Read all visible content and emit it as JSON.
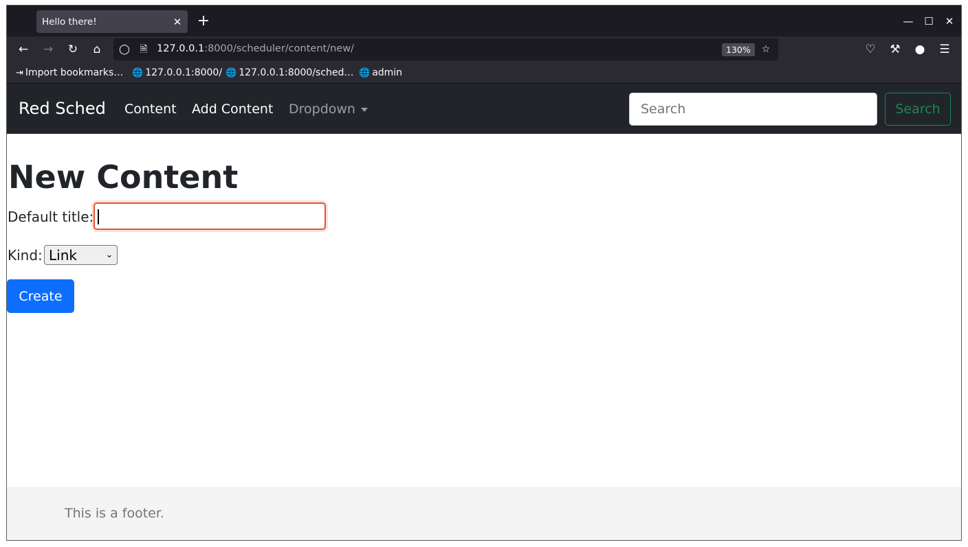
{
  "browser": {
    "tab_title": "Hello there!",
    "tab_close": "✕",
    "new_tab": "+",
    "url_host": "127.0.0.1",
    "url_rest": ":8000/scheduler/content/new/",
    "zoom": "130%",
    "bookmarks": [
      {
        "label": "Import bookmarks…",
        "icon": "import-icon"
      },
      {
        "label": "127.0.0.1:8000/",
        "icon": "globe-icon"
      },
      {
        "label": "127.0.0.1:8000/sched…",
        "icon": "globe-icon"
      },
      {
        "label": "admin",
        "icon": "globe-icon"
      }
    ]
  },
  "navbar": {
    "brand": "Red Sched",
    "links": [
      "Content",
      "Add Content",
      "Dropdown"
    ],
    "search_placeholder": "Search",
    "search_button": "Search"
  },
  "main": {
    "title": "New Content",
    "default_title_label": "Default title:",
    "default_title_value": "",
    "kind_label": "Kind:",
    "kind_value": "Link",
    "create_button": "Create"
  },
  "footer": {
    "text": "This is a footer."
  },
  "colors": {
    "navbar_bg": "#212529",
    "primary": "#0d6efd",
    "success": "#198754",
    "focus_border": "#e2572b"
  }
}
